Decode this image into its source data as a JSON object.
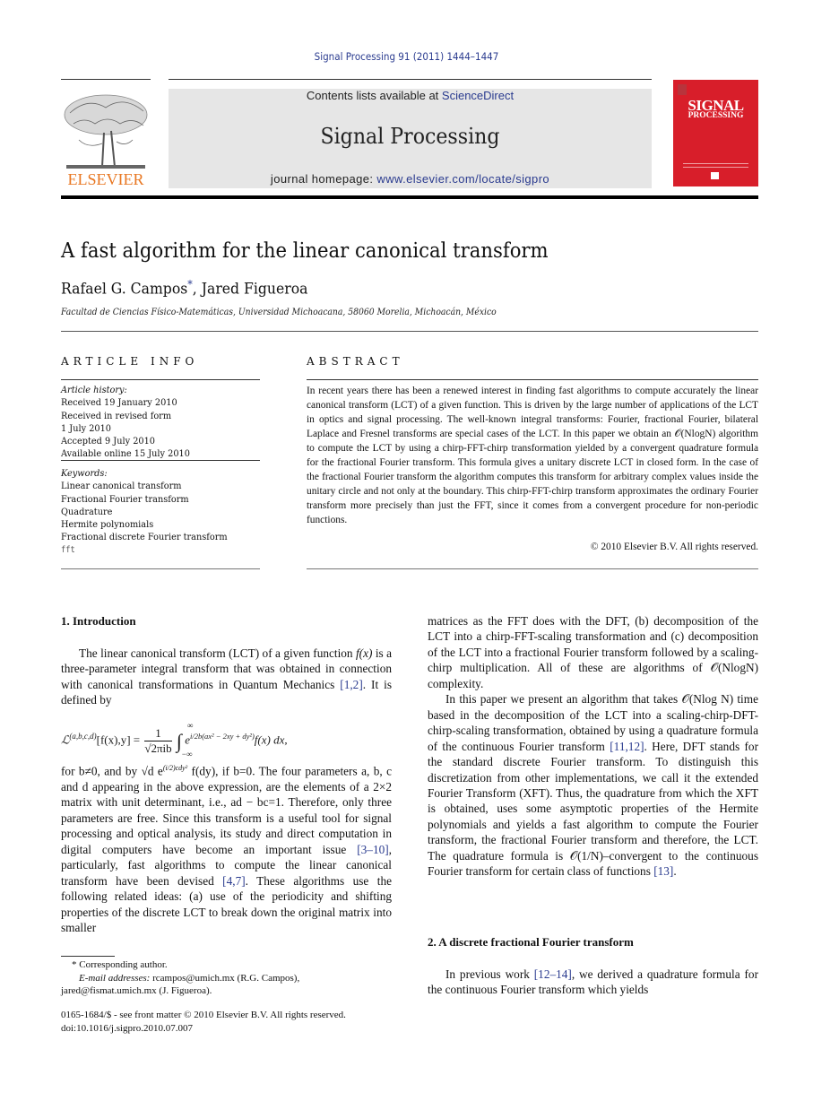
{
  "header": {
    "journal_ref": "Signal Processing 91 (2011) 1444–1447",
    "contents_prefix": "Contents lists available at ",
    "contents_link": "ScienceDirect",
    "journal_name": "Signal Processing",
    "homepage_prefix": "journal homepage: ",
    "homepage_link": "www.elsevier.com/locate/sigpro",
    "publisher_logo_text": "ELSEVIER",
    "cover_title_line1": "SIGNAL",
    "cover_title_line2": "PROCESSING",
    "colors": {
      "link": "#2a3b8f",
      "elsevier_orange": "#e87722",
      "cover_red": "#d81e2a",
      "banner_gray": "#e6e6e6"
    }
  },
  "article": {
    "title": "A fast algorithm for the linear canonical transform",
    "authors": [
      {
        "name": "Rafael G. Campos",
        "mark": "*"
      },
      {
        "name": "Jared Figueroa",
        "mark": ""
      }
    ],
    "author_separator": ", ",
    "affiliation": "Facultad de Ciencias Físico-Matemáticas, Universidad Michoacana, 58060 Morelia, Michoacán, México"
  },
  "article_info": {
    "heading": "ARTICLE INFO",
    "history_label": "Article history:",
    "history": [
      "Received 19 January 2010",
      "Received in revised form",
      "1 July 2010",
      "Accepted 9 July 2010",
      "Available online 15 July 2010"
    ],
    "keywords_label": "Keywords:",
    "keywords": [
      "Linear canonical transform",
      "Fractional Fourier transform",
      "Quadrature",
      "Hermite polynomials",
      "Fractional discrete Fourier transform",
      "fft"
    ]
  },
  "abstract": {
    "heading": "ABSTRACT",
    "text": "In recent years there has been a renewed interest in finding fast algorithms to compute accurately the linear canonical transform (LCT) of a given function. This is driven by the large number of applications of the LCT in optics and signal processing. The well-known integral transforms: Fourier, fractional Fourier, bilateral Laplace and Fresnel transforms are special cases of the LCT. In this paper we obtain an 𝒪(NlogN) algorithm to compute the LCT by using a chirp-FFT-chirp transformation yielded by a convergent quadrature formula for the fractional Fourier transform. This formula gives a unitary discrete LCT in closed form. In the case of the fractional Fourier transform the algorithm computes this transform for arbitrary complex values inside the unitary circle and not only at the boundary. This chirp-FFT-chirp transform approximates the ordinary Fourier transform more precisely than just the FFT, since it comes from a convergent procedure for non-periodic functions.",
    "copyright": "© 2010 Elsevier B.V. All rights reserved."
  },
  "section1": {
    "heading": "1.  Introduction",
    "para1_a": "The linear canonical transform (LCT) of a given function ",
    "para1_fx": "f(x)",
    "para1_b": " is a three-parameter integral transform that was obtained in connection with canonical transformations in Quantum Mechanics ",
    "para1_cite": "[1,2]",
    "para1_c": ". It is defined by",
    "equation": {
      "lhs": "ℒ",
      "lhs_sup": "(a,b,c,d)",
      "lhs_args": "[f(x),y] =",
      "frac_num": "1",
      "frac_den": "√2πib",
      "integral": "∫",
      "int_upper": "∞",
      "int_lower": "−∞",
      "exp_base": "e",
      "exponent": "i/2b(ax² − 2xy + dy²)",
      "rhs": "f(x) dx,"
    },
    "para2_a": "for b≠0, and by √d e",
    "para2_exp": "(i/2)cdy²",
    "para2_b": " f(dy), if b=0. The four parameters a, b, c and d appearing in the above expression, are the elements of a 2×2 matrix with unit determinant, i.e., ad − bc=1. Therefore, only three parameters are free. Since this transform is a useful tool for signal processing and optical analysis, its study and direct computation in digital computers have become an important issue ",
    "para2_cite1": "[3–10]",
    "para2_c": ", particularly, fast algorithms to compute the linear canonical transform have been devised ",
    "para2_cite2": "[4,7]",
    "para2_d": ". These algorithms use the following related ideas: (a) use of the periodicity and shifting properties of the discrete LCT to break down the original matrix into smaller",
    "right_para1": "matrices as the FFT does with the DFT, (b) decomposition of the LCT into a chirp-FFT-scaling transformation and (c) decomposition of the LCT into a fractional Fourier transform followed by a scaling-chirp multiplication. All of these are algorithms of 𝒪(NlogN) complexity.",
    "right_para2_a": "In this paper we present an algorithm that takes 𝒪(Nlog N) time based in the decomposition of the LCT into a scaling-chirp-DFT-chirp-scaling transformation, obtained by using a quadrature formula of the continuous Fourier transform ",
    "right_para2_cite1": "[11,12]",
    "right_para2_b": ". Here, DFT stands for the standard discrete Fourier transform. To distinguish this discretization from other implementations, we call it the extended Fourier Transform (XFT). Thus, the quadrature from which the XFT is obtained, uses some asymptotic properties of the Hermite polynomials and yields a fast algorithm to compute the Fourier transform, the fractional Fourier transform and therefore, the LCT. The quadrature formula is 𝒪(1/N)–convergent to the continuous Fourier transform for certain class of functions ",
    "right_para2_cite2": "[13]",
    "right_para2_c": "."
  },
  "section2": {
    "heading": "2.  A discrete fractional Fourier transform",
    "para_a": "In previous work ",
    "para_cite": "[12–14]",
    "para_b": ", we derived a quadrature formula for the continuous Fourier transform which yields"
  },
  "footnotes": {
    "corresponding": "* Corresponding author.",
    "email_label": "E-mail addresses:",
    "email1": " rcampos@umich.mx (R.G. Campos),",
    "email2": "jared@fismat.umich.mx (J. Figueroa).",
    "front_matter": "0165-1684/$ - see front matter © 2010 Elsevier B.V. All rights reserved.",
    "doi": "doi:10.1016/j.sigpro.2010.07.007"
  }
}
